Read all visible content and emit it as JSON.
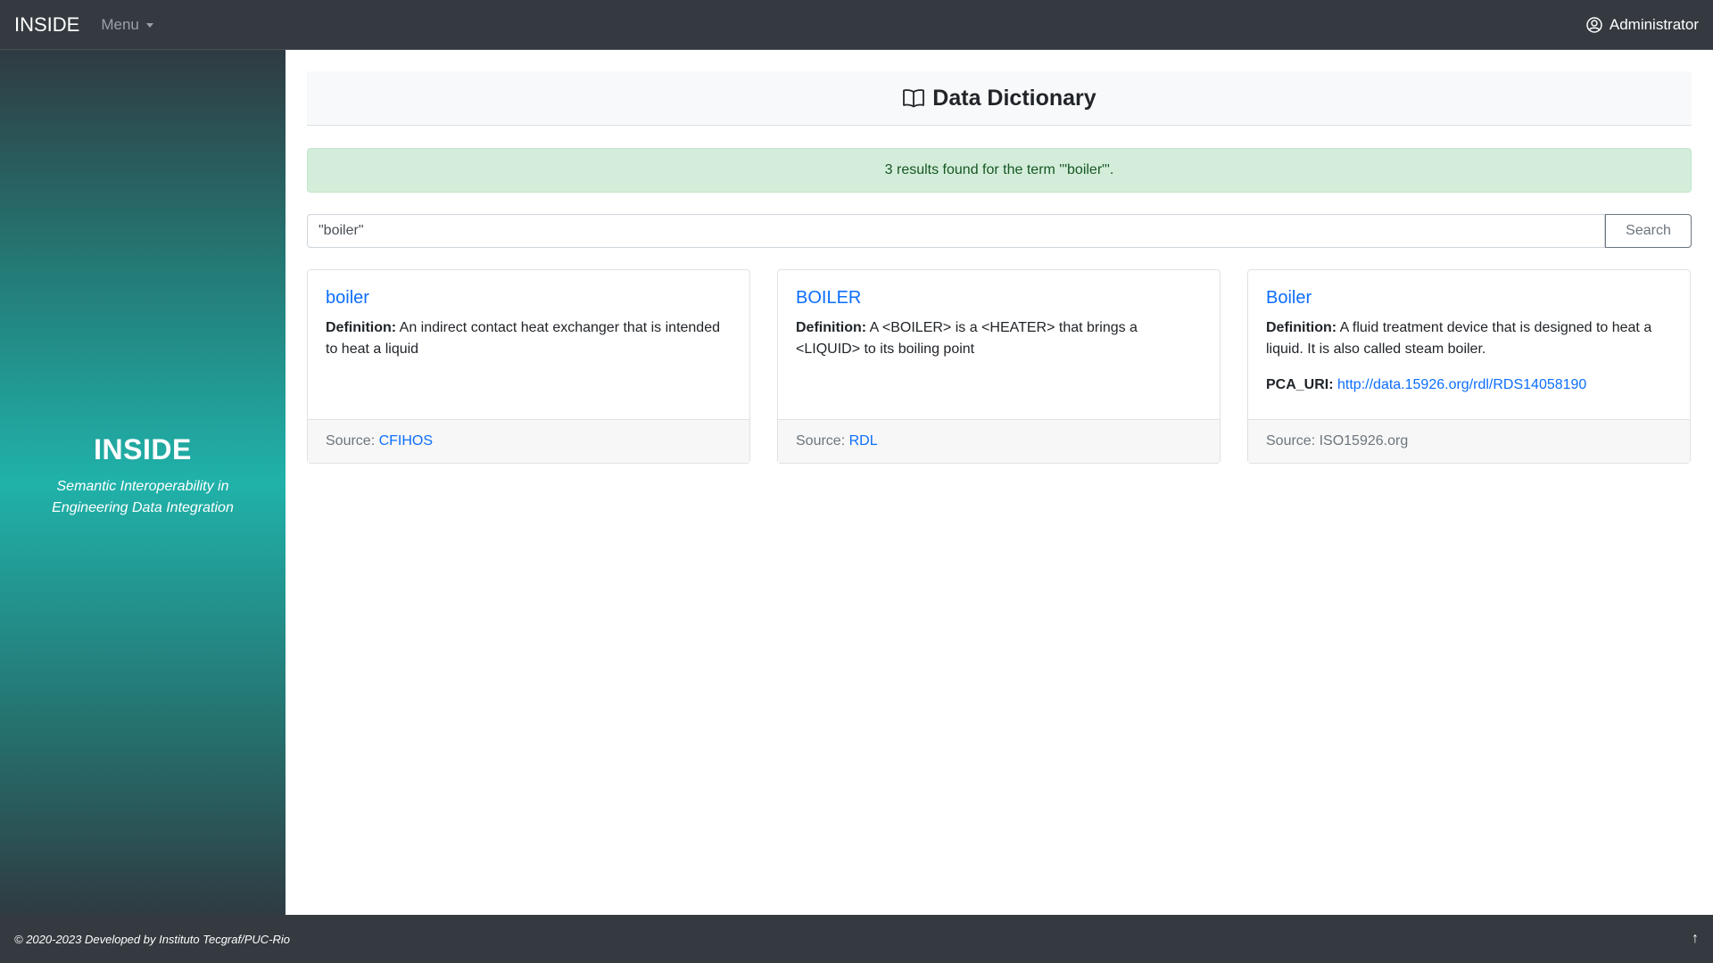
{
  "navbar": {
    "brand": "INSIDE",
    "menu_label": "Menu",
    "user_label": "Administrator"
  },
  "sidebar": {
    "title": "INSIDE",
    "subtitle": "Semantic Interoperability in Engineering Data Integration"
  },
  "header": {
    "title": "Data Dictionary",
    "icon": "book-icon"
  },
  "alert": {
    "message": "3 results found for the term '\"boiler\"'."
  },
  "search": {
    "value": "\"boiler\"",
    "button_label": "Search"
  },
  "results": [
    {
      "title": "boiler",
      "definition_label": "Definition:",
      "definition": "An indirect contact heat exchanger that is intended to heat a liquid",
      "source_label": "Source:",
      "source": "CFIHOS"
    },
    {
      "title": "BOILER",
      "definition_label": "Definition:",
      "definition": "A <BOILER> is a <HEATER> that brings a <LIQUID> to its boiling point",
      "source_label": "Source:",
      "source": "RDL"
    },
    {
      "title": "Boiler",
      "definition_label": "Definition:",
      "definition": "A fluid treatment device that is designed to heat a liquid. It is also called steam boiler.",
      "uri_label": "PCA_URI:",
      "uri": "http://data.15926.org/rdl/RDS14058190",
      "source_label": "Source:",
      "source": "ISO15926.org"
    }
  ],
  "footer": {
    "copyright": "© 2020-2023 Developed by Instituto Tecgraf/PUC-Rio",
    "top_icon": "arrow-up-icon"
  },
  "colors": {
    "navbar": "#343a40",
    "accent_link": "#0d6efd",
    "alert_bg": "#d4edda",
    "sidebar_teal": "#20b2aa"
  }
}
